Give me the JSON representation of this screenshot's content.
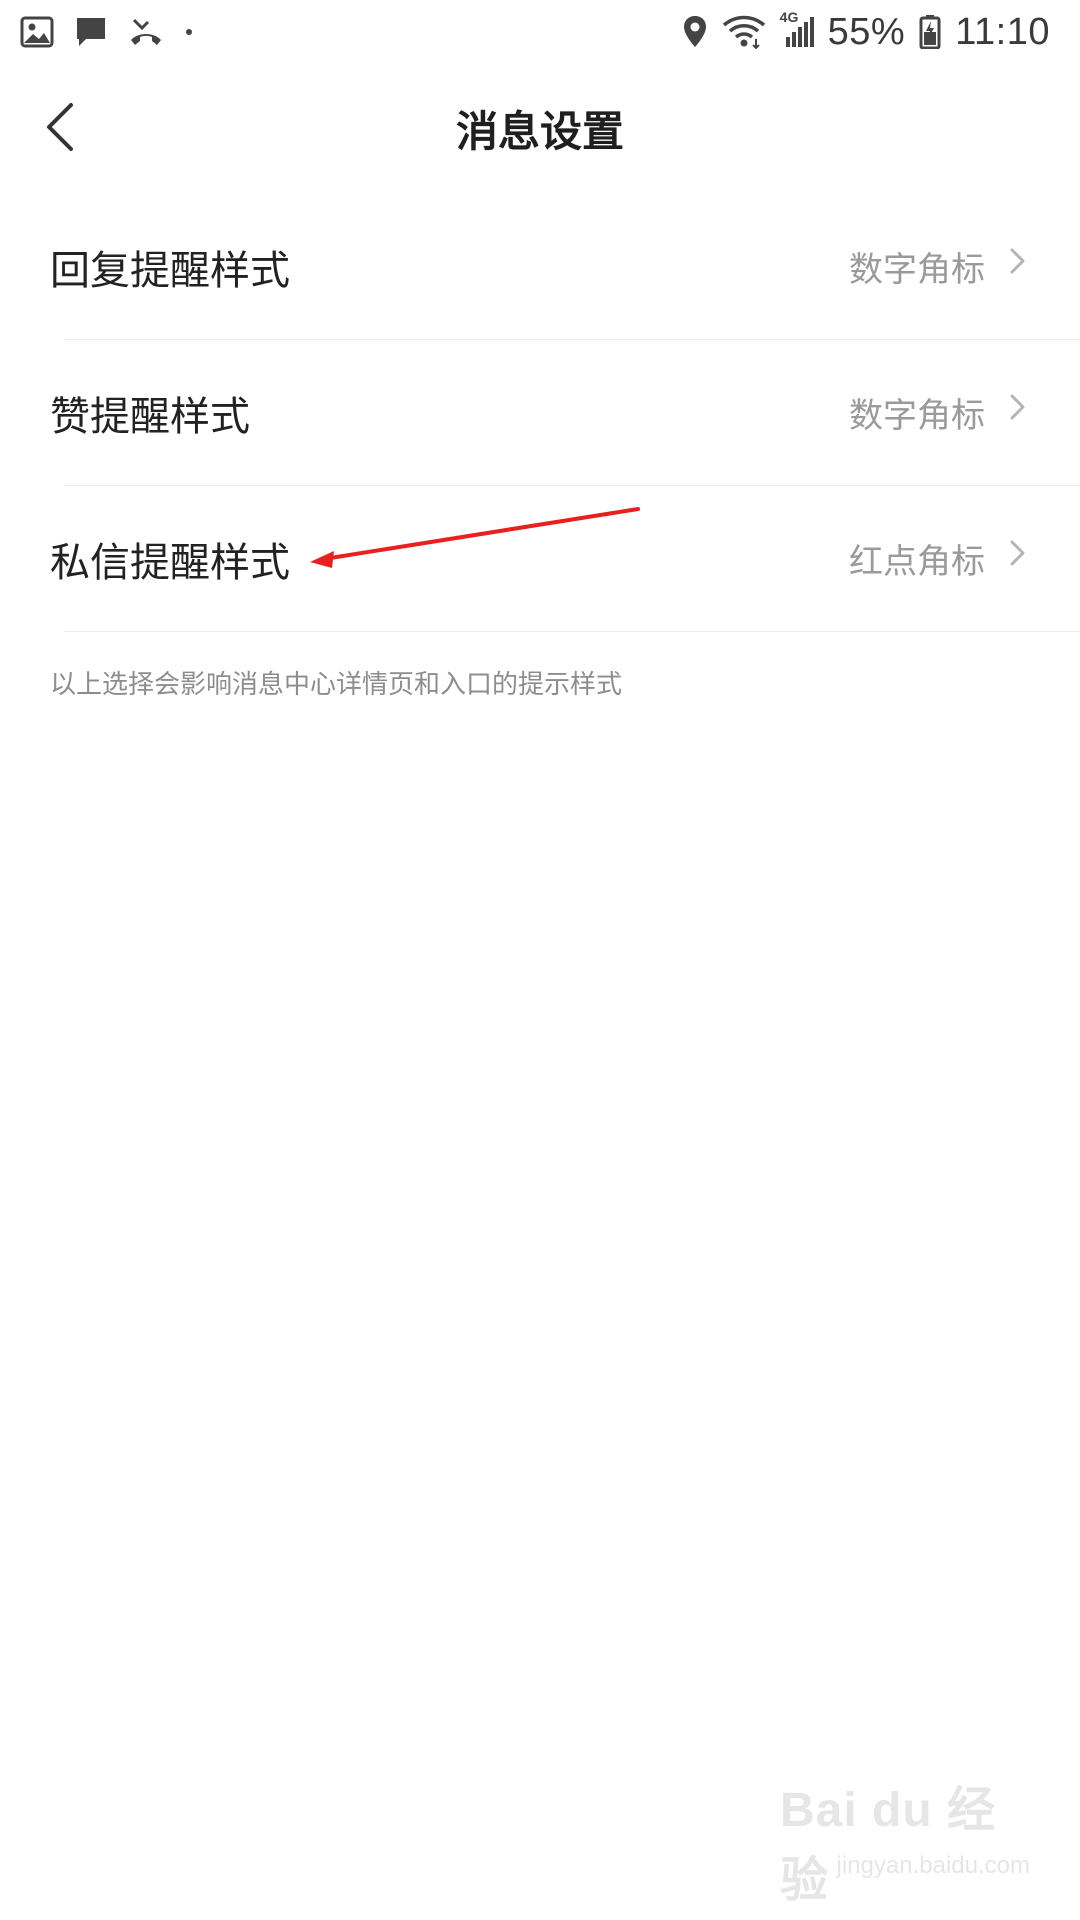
{
  "status_bar": {
    "left_icons": [
      "gallery-icon",
      "message-icon",
      "missed-call-icon",
      "dot-icon"
    ],
    "right_icons": [
      "location-icon",
      "wifi-icon",
      "signal-icon",
      "battery-icon"
    ],
    "network_label": "4G",
    "battery_percent": "55%",
    "time": "11:10"
  },
  "header": {
    "title": "消息设置",
    "back_icon": "chevron-left-icon"
  },
  "settings": {
    "items": [
      {
        "label": "回复提醒样式",
        "value": "数字角标"
      },
      {
        "label": "赞提醒样式",
        "value": "数字角标"
      },
      {
        "label": "私信提醒样式",
        "value": "红点角标"
      }
    ],
    "footnote": "以上选择会影响消息中心详情页和入口的提示样式"
  },
  "annotation": {
    "color": "#e8201e",
    "target": "私信提醒样式"
  },
  "watermark": {
    "text": "Bai du 经验",
    "sub": "jingyan.baidu.com"
  },
  "colors": {
    "text_primary": "#222222",
    "text_secondary": "#9a9a9a",
    "divider": "#ececec",
    "background": "#ffffff"
  }
}
